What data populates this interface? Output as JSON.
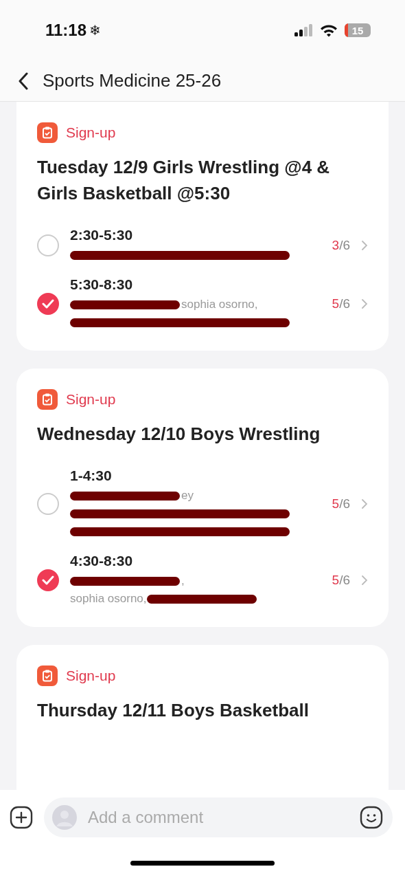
{
  "status_bar": {
    "time": "11:18",
    "time_icon": "❄",
    "battery": "15"
  },
  "header": {
    "title": "Sports Medicine 25-26"
  },
  "posts": [
    {
      "tag": "Sign-up",
      "title": "Tuesday 12/9 Girls Wrestling @4 & Girls Basketball @5:30",
      "slots": [
        {
          "time": "2:30-5:30",
          "selected": false,
          "taken": "3",
          "total": "/6",
          "lines": [
            [
              {
                "kind": "redacted"
              }
            ]
          ]
        },
        {
          "time": "5:30-8:30",
          "selected": true,
          "taken": "5",
          "total": "/6",
          "lines": [
            [
              {
                "kind": "redacted"
              },
              {
                "kind": "text",
                "text": "sophia osorno,"
              }
            ],
            [
              {
                "kind": "redacted"
              }
            ]
          ]
        }
      ]
    },
    {
      "tag": "Sign-up",
      "title": "Wednesday 12/10 Boys Wrestling",
      "slots": [
        {
          "time": "1-4:30",
          "selected": false,
          "taken": "5",
          "total": "/6",
          "lines": [
            [
              {
                "kind": "redacted"
              },
              {
                "kind": "text",
                "text": "ey"
              }
            ],
            [
              {
                "kind": "redacted"
              }
            ],
            [
              {
                "kind": "redacted"
              }
            ]
          ]
        },
        {
          "time": "4:30-8:30",
          "selected": true,
          "taken": "5",
          "total": "/6",
          "lines": [
            [
              {
                "kind": "redacted"
              },
              {
                "kind": "text",
                "text": ","
              }
            ],
            [
              {
                "kind": "text",
                "text": "sophia osorno,"
              },
              {
                "kind": "redacted"
              }
            ]
          ]
        }
      ]
    },
    {
      "tag": "Sign-up",
      "title": "Thursday 12/11 Boys Basketball"
    }
  ],
  "composer": {
    "placeholder": "Add a comment"
  }
}
